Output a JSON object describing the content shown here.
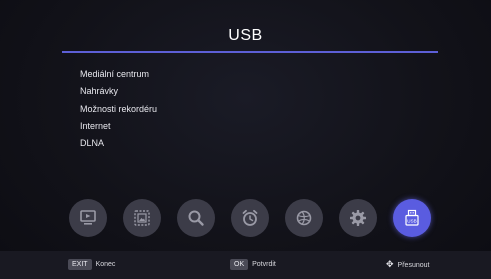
{
  "header": {
    "title": "USB"
  },
  "menu": {
    "items": [
      {
        "label": "Mediální centrum"
      },
      {
        "label": "Nahrávky"
      },
      {
        "label": "Možnosti rekordéru"
      },
      {
        "label": "Internet"
      },
      {
        "label": "DLNA"
      }
    ]
  },
  "iconbar": {
    "usb_label": "USB",
    "active": "usb",
    "icons": [
      "tv-icon",
      "picture-icon",
      "search-icon",
      "alarm-clock-icon",
      "globe-icon",
      "gear-icon",
      "usb-icon"
    ]
  },
  "footer": {
    "exit_key": "EXIT",
    "exit_label": "Konec",
    "ok_key": "OK",
    "ok_label": "Potvrdit",
    "move_label": "Přesunout"
  },
  "colors": {
    "accent": "#5a5ce0",
    "rule": "#5d5fd6",
    "icon_bg": "#3c3c48"
  }
}
